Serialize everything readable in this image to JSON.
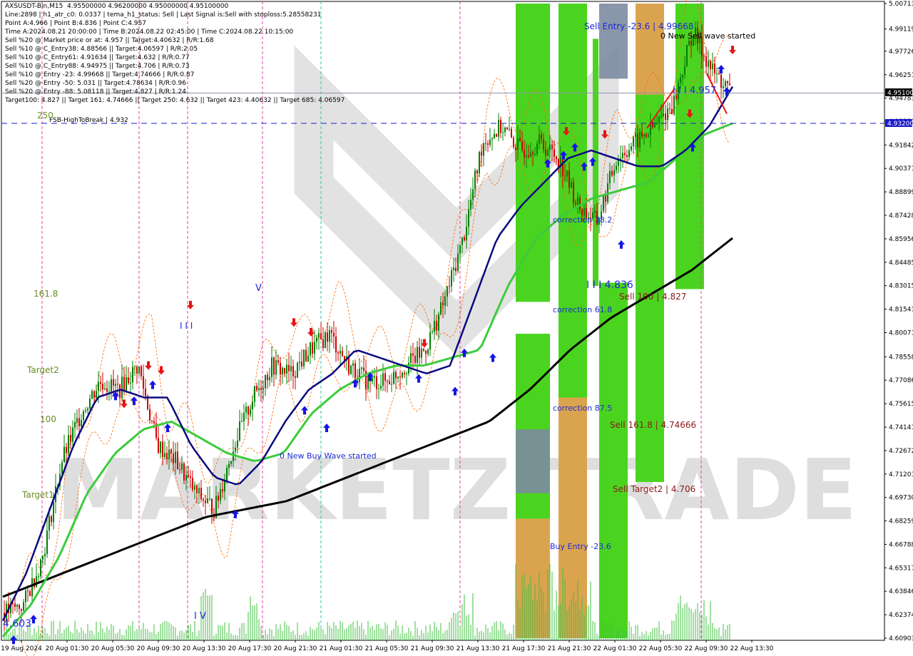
{
  "header": {
    "lines": [
      "AXSUSDT-Bin,M15  4.95500000 4.96200000 4.95000000 4.95100000",
      "Line:2898 | h1_atr_c0: 0.0337 | tema_h1_status: Sell | Last Signal is:Sell with stoploss:5.28558231",
      "Point A:4.966 | Point B:4.836 | Point C:4.957",
      "Time A:2024.08.21 20:00:00 | Time B:2024.08.22 02:45:00 | Time C:2024.08.22 10:15:00",
      "Sell %20 @ Market price or at: 4.957 || Target:4.40632 | R/R:1.68",
      "Sell %10 @ C_Entry38: 4.88566 || Target:4.06597 | R/R:2.05",
      "Sell %10 @ C_Entry61: 4.91634 || Target:4.632 | R/R:0.77",
      "Sell %10 @ C_Entry88: 4.94975 || Target:4.706 | R/R:0.73",
      "Sell %10 @ Entry -23: 4.99668 || Target:4.74666 | R/R:0.87",
      "Sell %20 @ Entry -50: 5.031 || Target:4.78634 | R/R:0.96",
      "Sell %20 @ Entry -88: 5.08118 || Target:4.827 | R/R:1.24",
      "Target100: 4.827 || Target 161: 4.74666 || Target 250: 4.632 || Target 423: 4.40632 || Target 685: 4.06597"
    ]
  },
  "colors": {
    "bull": "#008000",
    "bear": "#d00000",
    "ema_fast": "#0a0a80",
    "ema_mid": "#3ccb3c",
    "ema_slow": "#000000",
    "zone_green": "#4ad41f",
    "zone_orange": "#f39b58",
    "zone_gray": "#7d8ba0",
    "dashed_line": "#1a1acc",
    "current_price_bg": "#000000",
    "dashed_price_bg": "#1a1acc",
    "annotation_blue": "#1e2ad8",
    "annotation_brown": "#8b1a1a",
    "annotation_olive": "#6b8e23",
    "volume": "#40c040",
    "watermark": "#cfcfcf"
  },
  "watermark": "MARKETZITRADE",
  "price_axis": {
    "ticks": [
      "5.00713",
      "4.99119",
      "4.97726",
      "4.96251",
      "4.94783",
      "4.93331",
      "4.91842",
      "4.90371",
      "4.88899",
      "4.87428",
      "4.85956",
      "4.84485",
      "4.83015",
      "4.81543",
      "4.80071",
      "4.78558",
      "4.77086",
      "4.75615",
      "4.74141",
      "4.72672",
      "4.71201",
      "4.69730",
      "4.68259",
      "4.66788",
      "4.65317",
      "4.63846",
      "4.62374",
      "4.60903"
    ],
    "current_price": "4.95100",
    "dashed_price": "4.93200"
  },
  "time_axis": {
    "labels": [
      "19 Aug 2024",
      "20 Aug 01:30",
      "20 Aug 05:30",
      "20 Aug 09:30",
      "20 Aug 13:30",
      "20 Aug 17:30",
      "20 Aug 21:30",
      "21 Aug 01:30",
      "21 Aug 05:30",
      "21 Aug 09:30",
      "21 Aug 13:30",
      "21 Aug 17:30",
      "21 Aug 21:30",
      "22 Aug 01:30",
      "22 Aug 05:30",
      "22 Aug 09:30",
      "22 Aug 13:30"
    ]
  },
  "annotations": {
    "fsb": "FSB-HighToBreak | 4.932",
    "fib_250": "250",
    "fib_1618": "161.8",
    "fib_target2": "Target2",
    "fib_100": "100",
    "fib_target1": "Target1",
    "sell_entry": "Sell Entry -23.6 | 4.99668",
    "new_sell_wave": "0 New Sell wave started",
    "point_c": "I I I 4.957",
    "correction_382": "correction 38.2",
    "point_b": "I I I 4.836",
    "sell_100": "Sell 100 | 4.827",
    "correction_618": "correction 61.8",
    "correction_875": "correction 87.5",
    "sell_1618": "Sell 161.8 | 4.74666",
    "sell_target2": "Sell Target2 | 4.706",
    "buy_entry": "Buy Entry -23.6",
    "new_buy_wave": "0 New Buy Wave started",
    "low_label": "4.603",
    "marker_iv": "I V",
    "marker_v": "V",
    "marker_iii": "I I I"
  },
  "chart_data": {
    "type": "candlestick",
    "symbol": "AXSUSDT-Bin",
    "timeframe": "M15",
    "ylim": [
      4.60903,
      5.00713
    ],
    "y_scale": "linear",
    "x_categories": [
      "19 Aug 2024",
      "20 Aug 01:30",
      "20 Aug 05:30",
      "20 Aug 09:30",
      "20 Aug 13:30",
      "20 Aug 17:30",
      "20 Aug 21:30",
      "21 Aug 01:30",
      "21 Aug 05:30",
      "21 Aug 09:30",
      "21 Aug 13:30",
      "21 Aug 17:30",
      "21 Aug 21:30",
      "22 Aug 01:30",
      "22 Aug 05:30",
      "22 Aug 09:30",
      "22 Aug 13:30"
    ],
    "close_approx": [
      4.625,
      4.63,
      4.66,
      4.72,
      4.75,
      4.77,
      4.765,
      4.78,
      4.73,
      4.72,
      4.7,
      4.69,
      4.73,
      4.76,
      4.78,
      4.775,
      4.79,
      4.8,
      4.78,
      4.77,
      4.77,
      4.78,
      4.79,
      4.82,
      4.86,
      4.92,
      4.93,
      4.915,
      4.92,
      4.91,
      4.88,
      4.87,
      4.91,
      4.92,
      4.93,
      4.945,
      4.99,
      4.965,
      4.951
    ],
    "ema_fast_approx": [
      4.62,
      4.65,
      4.69,
      4.73,
      4.76,
      4.765,
      4.76,
      4.76,
      4.73,
      4.71,
      4.705,
      4.72,
      4.745,
      4.765,
      4.775,
      4.79,
      4.785,
      4.78,
      4.775,
      4.78,
      4.82,
      4.86,
      4.88,
      4.895,
      4.91,
      4.915,
      4.91,
      4.905,
      4.905,
      4.915,
      4.93,
      4.955
    ],
    "ema_mid_approx": [
      4.61,
      4.63,
      4.66,
      4.7,
      4.725,
      4.74,
      4.745,
      4.735,
      4.725,
      4.72,
      4.725,
      4.75,
      4.765,
      4.775,
      4.78,
      4.78,
      4.785,
      4.79,
      4.83,
      4.86,
      4.875,
      4.885,
      4.89,
      4.895,
      4.91,
      4.925,
      4.932
    ],
    "ema_slow_approx": [
      4.635,
      4.645,
      4.655,
      4.665,
      4.675,
      4.685,
      4.69,
      4.695,
      4.705,
      4.715,
      4.725,
      4.735,
      4.745,
      4.765,
      4.79,
      4.81,
      4.825,
      4.84,
      4.86
    ],
    "levels": [
      {
        "name": "FSB-HighToBreak",
        "value": 4.932
      },
      {
        "name": "Current price",
        "value": 4.951
      },
      {
        "name": "Sell Entry -23.6",
        "value": 4.99668
      },
      {
        "name": "Point C",
        "value": 4.957
      },
      {
        "name": "Point B",
        "value": 4.836
      },
      {
        "name": "Sell 100",
        "value": 4.827
      },
      {
        "name": "Sell 161.8",
        "value": 4.74666
      },
      {
        "name": "Sell Target2",
        "value": 4.706
      }
    ]
  }
}
